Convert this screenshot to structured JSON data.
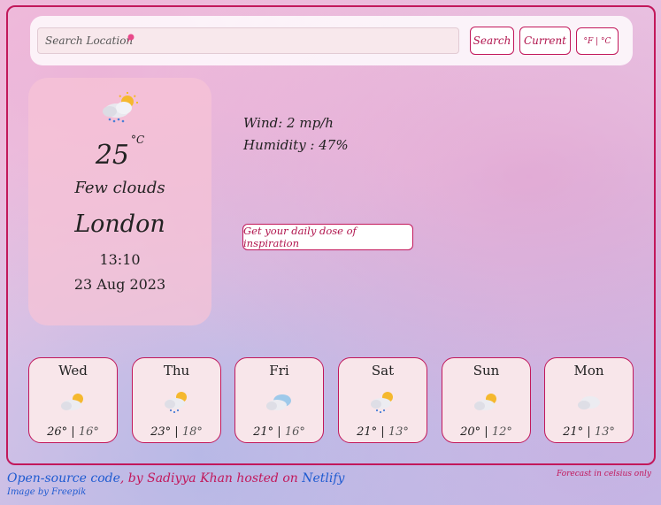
{
  "search": {
    "placeholder": "Search Location",
    "search_label": "Search",
    "current_label": "Current",
    "unit_label": "°F | °C"
  },
  "current": {
    "icon": "cloud-sun-rain-icon",
    "temp": "25",
    "unit": "°C",
    "description": "Few clouds",
    "city": "London",
    "time": "13:10",
    "date": "23 Aug 2023"
  },
  "details": {
    "wind": "Wind: 2 mp/h",
    "humidity": "Humidity : 47%"
  },
  "inspiration_label": "Get your daily dose of inspiration",
  "forecast": [
    {
      "day": "Wed",
      "icon": "few-clouds-icon",
      "high": "26°",
      "low": "16°"
    },
    {
      "day": "Thu",
      "icon": "sun-rain-icon",
      "high": "23°",
      "low": "18°"
    },
    {
      "day": "Fri",
      "icon": "scattered-clouds-icon",
      "high": "21°",
      "low": "16°"
    },
    {
      "day": "Sat",
      "icon": "sun-rain-icon",
      "high": "21°",
      "low": "13°"
    },
    {
      "day": "Sun",
      "icon": "few-clouds-icon",
      "high": "20°",
      "low": "12°"
    },
    {
      "day": "Mon",
      "icon": "cloud-icon",
      "high": "21°",
      "low": "13°"
    }
  ],
  "footer": {
    "open_source": "Open-source code",
    "by": ", by Sadiyya Khan hosted on",
    "netlify": "Netlify",
    "credit": "Image by Freepik",
    "note": "Forecast in celsius only"
  },
  "colors": {
    "accent": "#c2185b",
    "link_blue": "#1f5bd1",
    "card_pink": "#f6c4d6"
  }
}
